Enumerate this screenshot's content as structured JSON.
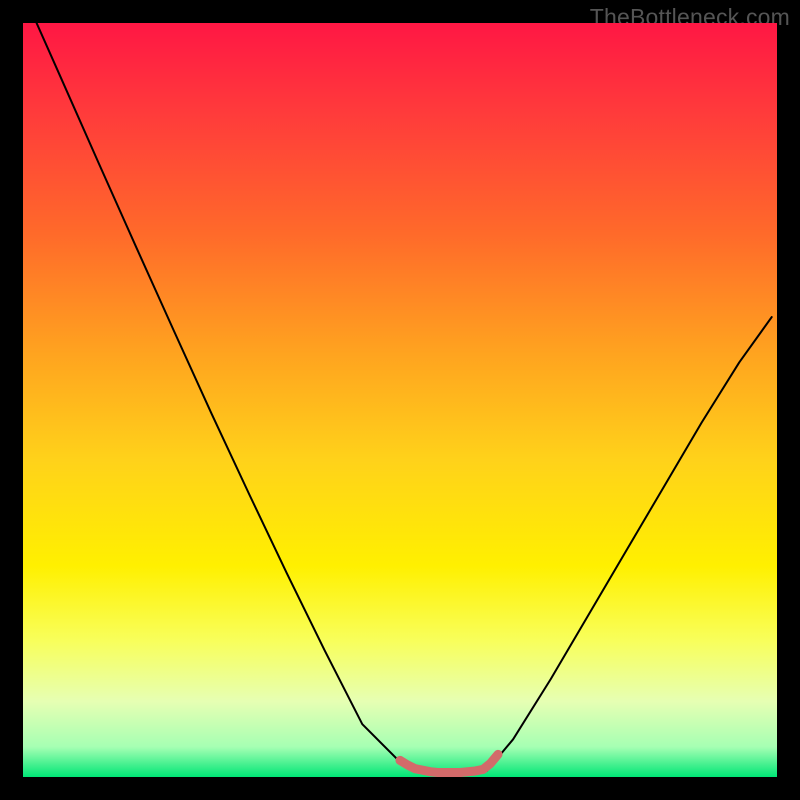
{
  "watermark": "TheBottleneck.com",
  "chart_data": {
    "type": "line",
    "title": "",
    "xlabel": "",
    "ylabel": "",
    "xlim": [
      0,
      1
    ],
    "ylim": [
      0,
      1
    ],
    "background": {
      "type": "vertical-gradient",
      "stops": [
        {
          "offset": 0.0,
          "color": "#ff1744"
        },
        {
          "offset": 0.12,
          "color": "#ff3b3b"
        },
        {
          "offset": 0.28,
          "color": "#ff6a2a"
        },
        {
          "offset": 0.44,
          "color": "#ffa41f"
        },
        {
          "offset": 0.58,
          "color": "#ffd21a"
        },
        {
          "offset": 0.72,
          "color": "#fff000"
        },
        {
          "offset": 0.82,
          "color": "#f8ff5c"
        },
        {
          "offset": 0.9,
          "color": "#e6ffb3"
        },
        {
          "offset": 0.96,
          "color": "#a6ffb3"
        },
        {
          "offset": 1.0,
          "color": "#00e676"
        }
      ]
    },
    "series": [
      {
        "name": "bottleneck-curve",
        "color": "#000000",
        "x": [
          0.018,
          0.05,
          0.1,
          0.15,
          0.2,
          0.25,
          0.3,
          0.35,
          0.4,
          0.45,
          0.5,
          0.528,
          0.55,
          0.58,
          0.615,
          0.65,
          0.7,
          0.75,
          0.8,
          0.85,
          0.9,
          0.95,
          0.993
        ],
        "y": [
          1.0,
          0.928,
          0.815,
          0.703,
          0.592,
          0.482,
          0.375,
          0.27,
          0.168,
          0.07,
          0.02,
          0.008,
          0.006,
          0.006,
          0.008,
          0.05,
          0.13,
          0.215,
          0.3,
          0.385,
          0.47,
          0.55,
          0.61
        ]
      },
      {
        "name": "minimum-highlight",
        "color": "#d36a6a",
        "stroke_width": 9,
        "x": [
          0.5,
          0.51,
          0.52,
          0.53,
          0.54,
          0.55,
          0.56,
          0.57,
          0.58,
          0.59,
          0.6,
          0.61,
          0.62,
          0.63
        ],
        "y": [
          0.022,
          0.016,
          0.011,
          0.009,
          0.007,
          0.006,
          0.006,
          0.006,
          0.006,
          0.007,
          0.008,
          0.01,
          0.018,
          0.03
        ]
      }
    ]
  }
}
